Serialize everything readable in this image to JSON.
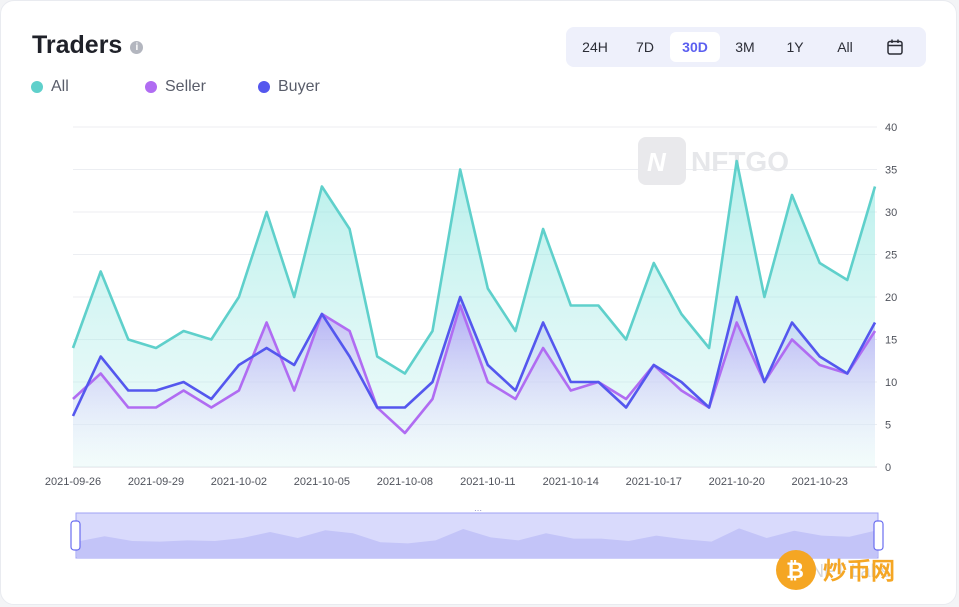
{
  "header": {
    "title": "Traders",
    "info_icon": "info-icon"
  },
  "range": {
    "buttons": [
      "24H",
      "7D",
      "30D",
      "3M",
      "1Y",
      "All"
    ],
    "active": "30D",
    "calendar_icon": "calendar-icon"
  },
  "watermark": {
    "text": "NFTGO",
    "footer_text": "NFT Labs",
    "badge_text": "炒币网"
  },
  "colors": {
    "all": "#5fd0cb",
    "seller": "#b06cf2",
    "buyer": "#5457ee",
    "accent": "#5b5ff0"
  },
  "chart_data": {
    "type": "area",
    "x": [
      "2021-09-26",
      "2021-09-27",
      "2021-09-28",
      "2021-09-29",
      "2021-09-30",
      "2021-10-01",
      "2021-10-02",
      "2021-10-03",
      "2021-10-04",
      "2021-10-05",
      "2021-10-06",
      "2021-10-07",
      "2021-10-08",
      "2021-10-09",
      "2021-10-10",
      "2021-10-11",
      "2021-10-12",
      "2021-10-13",
      "2021-10-14",
      "2021-10-15",
      "2021-10-16",
      "2021-10-17",
      "2021-10-18",
      "2021-10-19",
      "2021-10-20",
      "2021-10-21",
      "2021-10-22",
      "2021-10-23",
      "2021-10-24",
      "2021-10-25"
    ],
    "x_tick_labels": [
      "2021-09-26",
      "2021-09-29",
      "2021-10-02",
      "2021-10-05",
      "2021-10-08",
      "2021-10-11",
      "2021-10-14",
      "2021-10-17",
      "2021-10-20",
      "2021-10-23"
    ],
    "series": [
      {
        "name": "All",
        "values": [
          14,
          23,
          15,
          14,
          16,
          15,
          20,
          30,
          20,
          33,
          28,
          13,
          11,
          16,
          35,
          21,
          16,
          28,
          19,
          19,
          15,
          24,
          18,
          14,
          36,
          20,
          32,
          24,
          22,
          33
        ]
      },
      {
        "name": "Seller",
        "values": [
          8,
          11,
          7,
          7,
          9,
          7,
          9,
          17,
          9,
          18,
          16,
          7,
          4,
          8,
          19,
          10,
          8,
          14,
          9,
          10,
          8,
          12,
          9,
          7,
          17,
          10,
          15,
          12,
          11,
          16
        ]
      },
      {
        "name": "Buyer",
        "values": [
          6,
          13,
          9,
          9,
          10,
          8,
          12,
          14,
          12,
          18,
          13,
          7,
          7,
          10,
          20,
          12,
          9,
          17,
          10,
          10,
          7,
          12,
          10,
          7,
          20,
          10,
          17,
          13,
          11,
          17
        ]
      }
    ],
    "y_ticks": [
      0,
      5,
      10,
      15,
      20,
      25,
      30,
      35,
      40
    ],
    "ylim": [
      0,
      40
    ],
    "grid": true,
    "legend_position": "top-left"
  }
}
